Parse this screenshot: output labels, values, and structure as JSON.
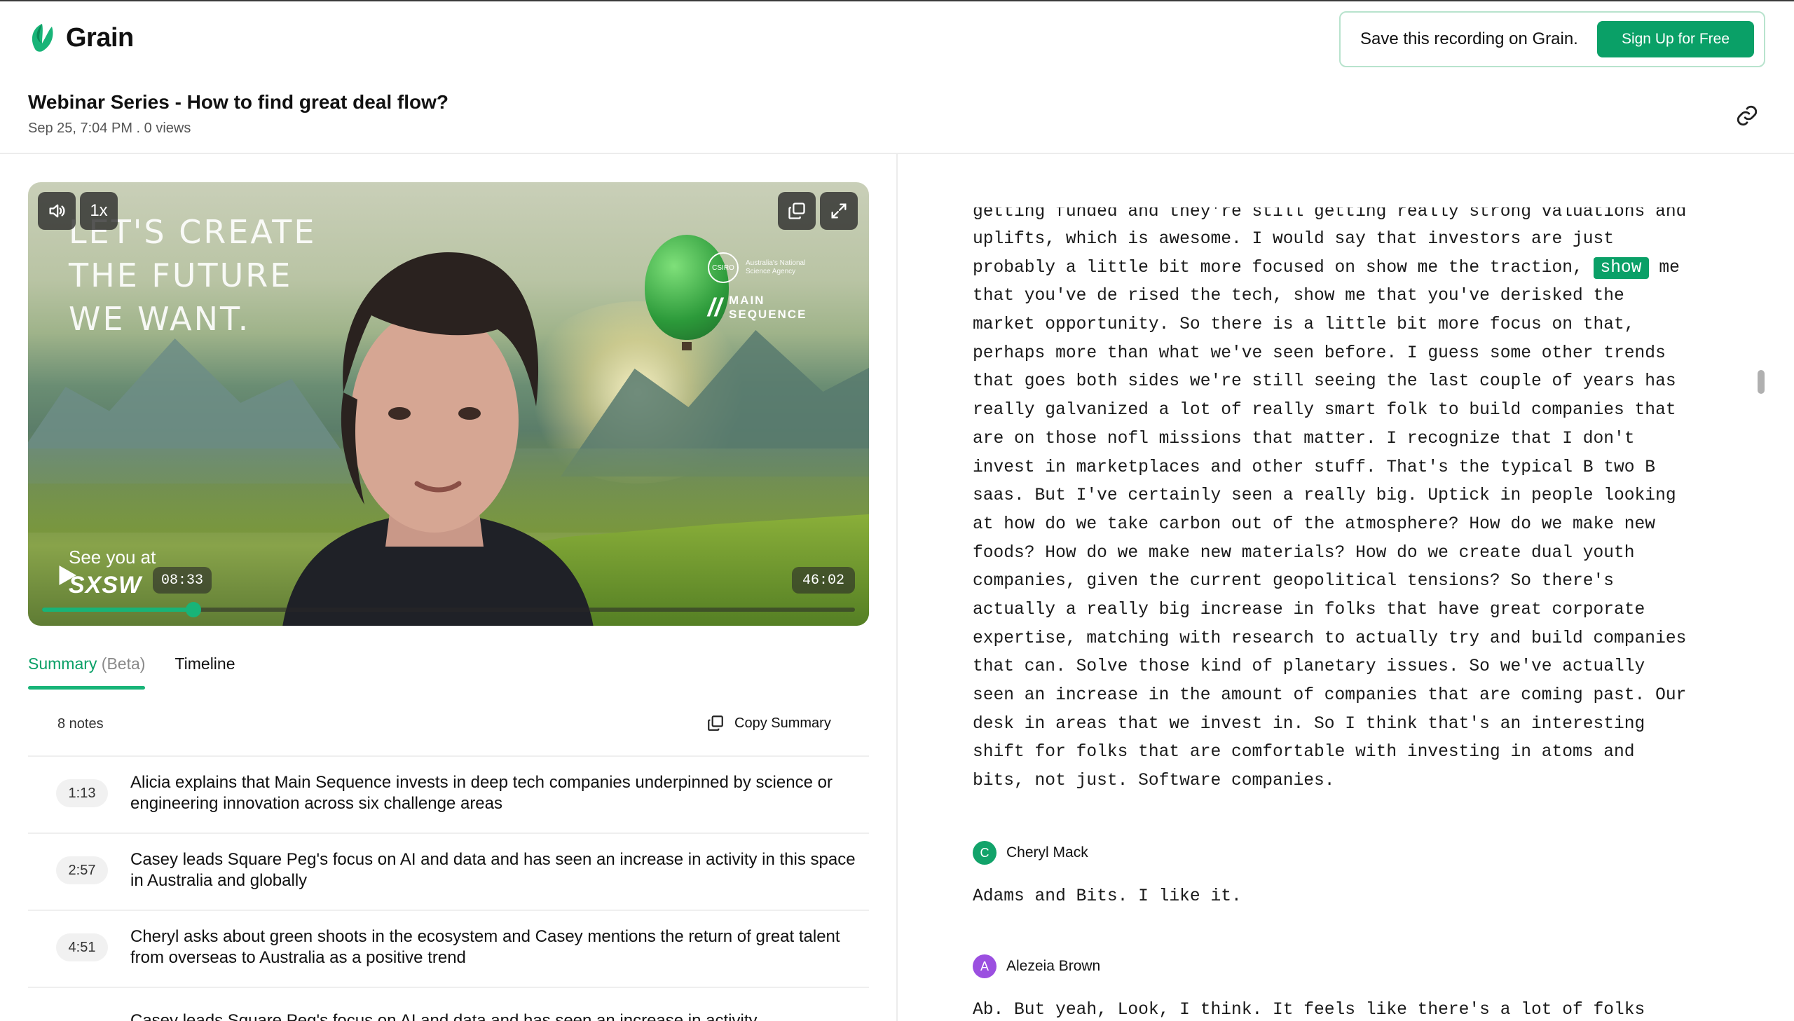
{
  "header": {
    "brand": "Grain",
    "cta_text": "Save this recording on Grain.",
    "cta_button": "Sign Up for Free",
    "title": "Webinar Series - How to find great deal flow?",
    "meta": "Sep 25, 7:04 PM . 0 views"
  },
  "player": {
    "speed": "1x",
    "current_time": "08:33",
    "duration": "46:02",
    "progress": 0.186,
    "video_text": {
      "tagline_lines": [
        "LET'S CREATE",
        "THE FUTURE",
        "WE WANT."
      ],
      "see_you": "See you at",
      "event": "SXSW",
      "brand_name_lines": [
        "MAIN",
        "SEQUENCE"
      ],
      "agency_lines": [
        "Australia's National",
        "Science Agency"
      ],
      "csiro": "CSIRO"
    }
  },
  "tabs": {
    "summary": "Summary",
    "summary_beta": "(Beta)",
    "timeline": "Timeline"
  },
  "summary": {
    "count": "8 notes",
    "copy_label": "Copy Summary",
    "notes": [
      {
        "time": "1:13",
        "text": "Alicia explains that Main Sequence invests in deep tech companies underpinned by science or engineering innovation across six challenge areas"
      },
      {
        "time": "2:57",
        "text": "Casey leads Square Peg's focus on AI and data and has seen an increase in activity in this space in Australia and globally"
      },
      {
        "time": "4:51",
        "text": "Cheryl asks about green shoots in the ecosystem and Casey mentions the return of great talent from overseas to Australia as a positive trend"
      }
    ],
    "partial_note": "Casey leads Square Peg's focus on AI and data and has seen an increase in activity"
  },
  "transcript": {
    "cut_top": "getting funded and they're still getting really strong valuations and",
    "line_1": "uplifts, which is awesome. I would say that investors are just",
    "line_2_pre": "probably a little bit more focused on show me the traction, ",
    "line_2_hl": "show",
    "line_2_post": " me",
    "lines": [
      "that you've de rised the tech, show me that you've derisked the",
      "market opportunity. So there is a little bit more focus on that,",
      "perhaps more than what we've seen before. I guess some other trends",
      "that goes both sides we're still seeing the last couple of years has",
      "really galvanized a lot of really smart folk to build companies that",
      "are on those nofl missions that matter. I recognize that I don't",
      "invest in marketplaces and other stuff. That's the typical B two B",
      "saas. But I've certainly seen a really big. Uptick in people looking",
      "at how do we take carbon out of the atmosphere? How do we make new",
      "foods? How do we make new materials? How do we create dual youth",
      "companies, given the current geopolitical tensions? So there's",
      "actually a really big increase in folks that have great corporate",
      "expertise, matching with research to actually try and build companies",
      "that can. Solve those kind of planetary issues. So we've actually",
      "seen an increase in the amount of companies that are coming past. Our",
      "desk in areas that we invest in. So I think that's an interesting",
      "shift for folks that are comfortable with investing in atoms and",
      "bits, not just. Software companies."
    ],
    "speakers": [
      {
        "initial": "C",
        "name": "Cheryl Mack",
        "color": "#12a36a",
        "text": "Adams and Bits. I like it."
      },
      {
        "initial": "A",
        "name": "Alezeia Brown",
        "color": "#9b4fe0",
        "text": "Ab. But yeah, Look, I think. It feels like there's a lot of folks"
      }
    ]
  },
  "colors": {
    "accent": "#0aa067",
    "progress": "#18b478"
  }
}
